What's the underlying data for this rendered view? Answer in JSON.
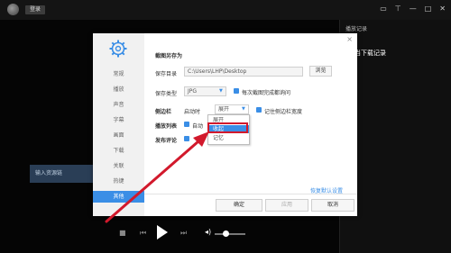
{
  "topbar": {
    "login_label": "登录",
    "icons": [
      "folder-icon",
      "pin-icon",
      "minimize-icon",
      "maximize-icon",
      "close-icon"
    ]
  },
  "right_panel": {
    "title": "播放记录",
    "line1": "暂",
    "line2": "当下载记录"
  },
  "input_bar": {
    "text": "输入资源链"
  },
  "dialog": {
    "close_symbol": "×",
    "nav": [
      "常规",
      "播放",
      "声音",
      "字幕",
      "画面",
      "下载",
      "关联",
      "热键",
      "其他"
    ],
    "active_nav_index": 8,
    "section_title": "截图另存为",
    "save_dir_label": "保存目录",
    "save_dir_value": "C:\\Users\\LHP\\Desktop",
    "browse_label": "浏览",
    "save_type_label": "保存类型",
    "save_type_value": "JPG",
    "ask_each_label": "每次截图完成都询问",
    "sidebar_label": "侧边栏",
    "startup_label": "启动时",
    "startup_value": "展开",
    "remember_width_label": "记住侧边栏宽度",
    "playlist_label": "播放列表",
    "playlist_check_label": "自动",
    "publish_label": "发布评论",
    "dropdown_options": [
      "展开",
      "收起",
      "记忆"
    ],
    "dropdown_selected_index": 1,
    "restore_label": "恢复默认设置",
    "ok_label": "确定",
    "apply_label": "应用",
    "cancel_label": "取消"
  },
  "colors": {
    "accent": "#3a8ee6",
    "annotation": "#d2192c"
  }
}
